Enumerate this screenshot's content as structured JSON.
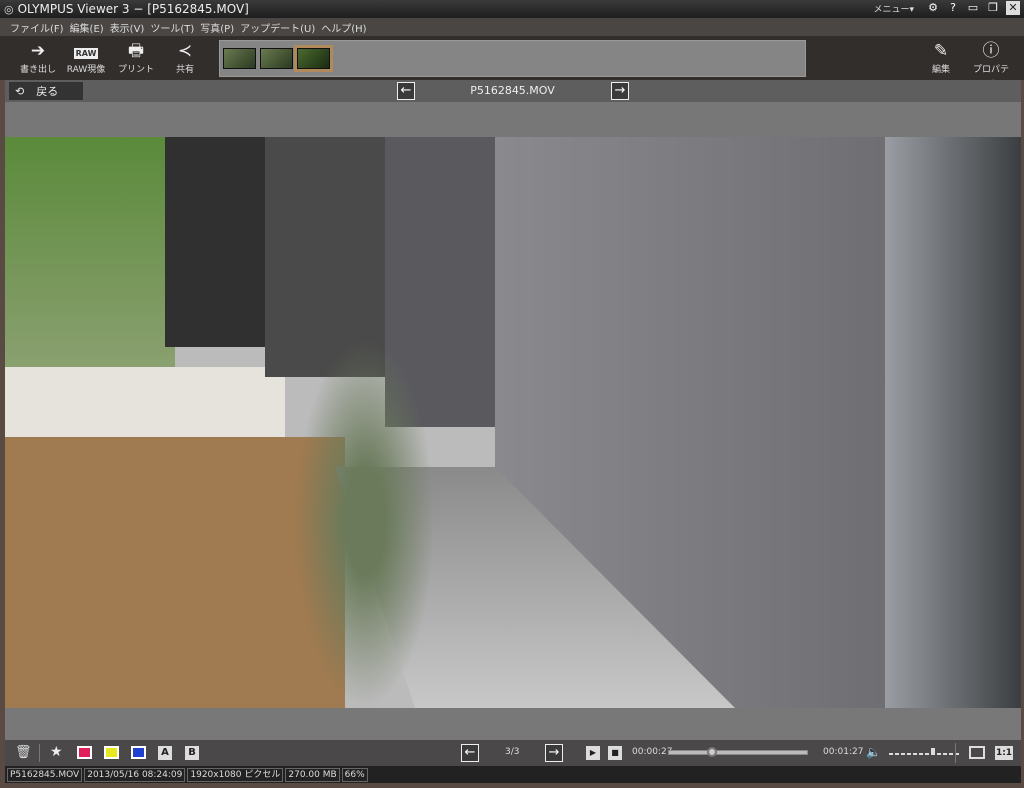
{
  "window": {
    "title": "OLYMPUS Viewer 3 − [P5162845.MOV]",
    "menu_label": "メニュー▾"
  },
  "menu": [
    "ファイル(F)",
    "編集(E)",
    "表示(V)",
    "ツール(T)",
    "写真(P)",
    "アップデート(U)",
    "ヘルプ(H)"
  ],
  "toolbar": {
    "export": "書き出し",
    "raw": "RAW現像",
    "raw_icon": "RAW",
    "print": "プリント",
    "share": "共有",
    "edit": "編集",
    "properties": "プロパティ"
  },
  "nav": {
    "back": "戻る",
    "filename": "P5162845.MOV"
  },
  "player": {
    "position": "3/3",
    "current_time": "00:00:27",
    "total_time": "00:01:27",
    "progress": 0.31,
    "volume": 0.6,
    "actual_size": "1:1"
  },
  "labels": {
    "a": "A",
    "b": "B"
  },
  "status": {
    "filename": "P5162845.MOV",
    "datetime": "2013/05/16 08:24:09",
    "resolution": "1920x1080 ピクセル",
    "size": "270.00 MB",
    "zoom": "66%"
  }
}
